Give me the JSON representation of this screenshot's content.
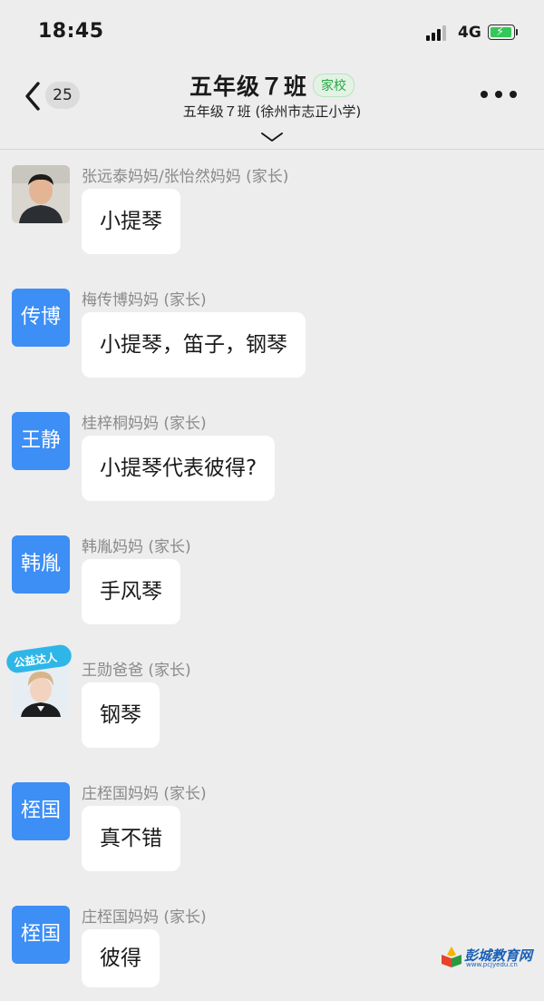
{
  "status_bar": {
    "time": "18:45",
    "network": "4G"
  },
  "nav": {
    "unread_count": "25",
    "title": "五年级７班",
    "tag": "家校",
    "subtitle": "五年级７班 (徐州市志正小学)"
  },
  "messages": [
    {
      "sender": "张远泰妈妈/张怡然妈妈 (家长)",
      "avatar_text": "",
      "avatar_kind": "photo-boy",
      "text": "小提琴"
    },
    {
      "sender": "梅传博妈妈 (家长)",
      "avatar_text": "传博",
      "avatar_kind": "text",
      "text": "小提琴，笛子，钢琴"
    },
    {
      "sender": "桂梓桐妈妈 (家长)",
      "avatar_text": "王静",
      "avatar_kind": "text",
      "text": "小提琴代表彼得?"
    },
    {
      "sender": "韩胤妈妈 (家长)",
      "avatar_text": "韩胤",
      "avatar_kind": "text",
      "text": "手风琴"
    },
    {
      "sender": "王勋爸爸 (家长)",
      "avatar_text": "",
      "avatar_kind": "photo-badge",
      "text": "钢琴"
    },
    {
      "sender": "庄桎国妈妈 (家长)",
      "avatar_text": "桎国",
      "avatar_kind": "text",
      "text": "真不错"
    },
    {
      "sender": "庄桎国妈妈 (家长)",
      "avatar_text": "桎国",
      "avatar_kind": "text",
      "text": "彼得"
    }
  ],
  "watermark": {
    "text": "彭城教育网",
    "url": "www.pcjyedu.cn",
    "badge_text": "公益达人"
  },
  "colors": {
    "avatar_blue": "#3d8ef5",
    "tag_green": "#28a745",
    "background": "#ededed"
  }
}
